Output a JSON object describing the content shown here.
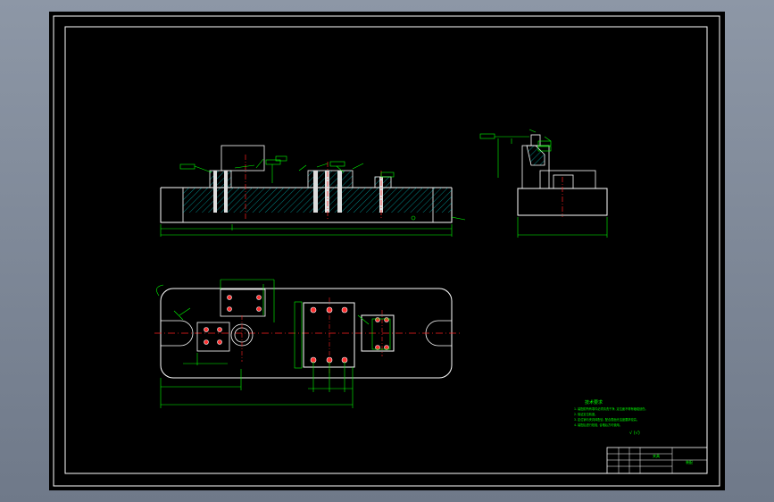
{
  "app": {
    "view": "model-space",
    "background": "#000000",
    "drawing_color": "#00ff00",
    "frame_color": "#ffffff",
    "center_color": "#ff2020",
    "hatch_color": "#00ffff"
  },
  "drawing": {
    "title_block": {
      "part_name": "夹具",
      "drawing_no": "装配"
    },
    "tech_notes": {
      "heading": "技术要求",
      "lines": [
        "1. 装配前所有零件必须清洗干净, 定位面不得有磕碰划伤。",
        "2. 保证定位精度。",
        "3. 定位销与夹具体配合, 配合表面光洁度要求较高。",
        "4. 装配后进行检验, 合格后方可使用。"
      ],
      "roughness_label": "√ (√)"
    }
  }
}
